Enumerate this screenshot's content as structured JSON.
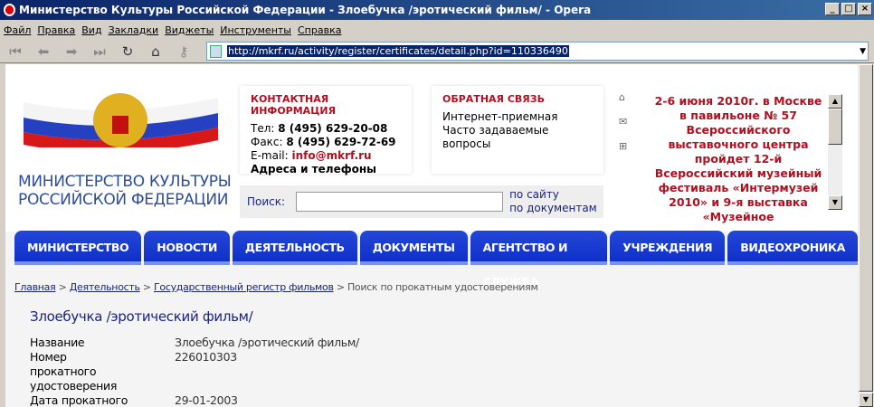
{
  "window": {
    "title": "Министерство Культуры Российской Федерации - Злоебучка /эротический фильм/ - Opera"
  },
  "menu": [
    "Файл",
    "Правка",
    "Вид",
    "Закладки",
    "Виджеты",
    "Инструменты",
    "Справка"
  ],
  "address": {
    "url": "http://mkrf.ru/activity/register/certificates/detail.php?id=110336490"
  },
  "logo": {
    "line1": "МИНИСТЕРСТВО КУЛЬТУРЫ",
    "line2": "РОССИЙСКОЙ ФЕДЕРАЦИИ"
  },
  "contact": {
    "heading": "КОНТАКТНАЯ ИНФОРМАЦИЯ",
    "tel_label": "Тел: ",
    "tel": "8 (495) 629-20-08",
    "fax_label": "Факс: ",
    "fax": "8 (495) 629-72-69",
    "email_label": "E-mail: ",
    "email": "info@mkrf.ru",
    "addr_bold": "Адреса",
    "addr_rest": " и телефоны"
  },
  "feedback": {
    "heading": "ОБРАТНАЯ СВЯЗЬ",
    "items": [
      "Интернет-приемная",
      "Часто задаваемые вопросы"
    ]
  },
  "search": {
    "label": "Поиск:",
    "value": "",
    "site": "по сайту",
    "docs": "по документам"
  },
  "news": "2-6 июня 2010г. в Москве в павильоне № 57 Всероссийского выставочного центра пройдет 12-й Всероссийский музейный фестиваль «Интермузей 2010» и 9-я выставка «Музейное",
  "nav": [
    "МИНИСТЕРСТВО",
    "НОВОСТИ",
    "ДЕЯТЕЛЬНОСТЬ",
    "ДОКУМЕНТЫ",
    "АГЕНТСТВО И СЛУЖБА",
    "УЧРЕЖДЕНИЯ",
    "ВИДЕОХРОНИКА"
  ],
  "breadcrumb": {
    "items": [
      "Главная",
      "Деятельность",
      "Государственный регистр фильмов"
    ],
    "current": "Поиск по прокатным удостоверениям",
    "sep": " > "
  },
  "page_title": "Злоебучка /эротический фильм/",
  "details": [
    {
      "key": "Название",
      "value": "Злоебучка /эротический фильм/"
    },
    {
      "key": "Номер прокатного удостоверения",
      "value": "226010303"
    },
    {
      "key": "Дата прокатного удостоверения",
      "value": "29-01-2003"
    }
  ]
}
